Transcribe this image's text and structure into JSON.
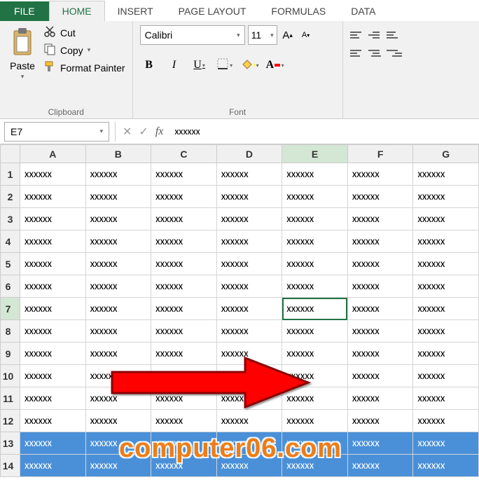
{
  "tabs": {
    "file": "FILE",
    "home": "HOME",
    "insert": "INSERT",
    "page_layout": "PAGE LAYOUT",
    "formulas": "FORMULAS",
    "data": "DATA"
  },
  "clipboard": {
    "paste": "Paste",
    "cut": "Cut",
    "copy": "Copy",
    "format_painter": "Format Painter",
    "label": "Clipboard"
  },
  "font": {
    "name": "Calibri",
    "size": "11",
    "label": "Font",
    "bold": "B",
    "italic": "I",
    "underline": "U",
    "grow": "A",
    "shrink": "A"
  },
  "namebox": "E7",
  "fx_label": "fx",
  "formula_value": "xxxxxx",
  "columns": [
    "A",
    "B",
    "C",
    "D",
    "E",
    "F",
    "G"
  ],
  "row_count": 14,
  "cell_value": "xxxxxx",
  "selected": {
    "col": "E",
    "row": 7
  },
  "highlight_rows": [
    13,
    14
  ],
  "watermark": "computer06.com"
}
